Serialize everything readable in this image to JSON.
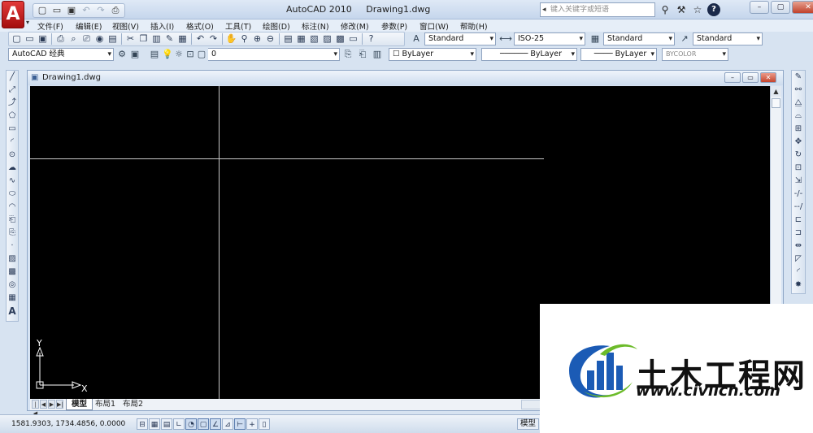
{
  "app": {
    "name": "AutoCAD 2010",
    "document": "Drawing1.dwg",
    "logo_letter": "A"
  },
  "search": {
    "placeholder": "键入关键字或短语"
  },
  "menu": [
    "文件(F)",
    "编辑(E)",
    "视图(V)",
    "插入(I)",
    "格式(O)",
    "工具(T)",
    "绘图(D)",
    "标注(N)",
    "修改(M)",
    "参数(P)",
    "窗口(W)",
    "帮助(H)"
  ],
  "styles": {
    "text_style": "Standard",
    "dim_style": "ISO-25",
    "table_style": "Standard",
    "multileader_style": "Standard"
  },
  "toolbar2": {
    "workspace": "AutoCAD 经典",
    "layer": "0",
    "color": "ByLayer",
    "linetype": "ByLayer",
    "lineweight": "ByLayer",
    "plotstyle": "BYCOLOR"
  },
  "drawing_window": {
    "title": "Drawing1.dwg",
    "ucs_y": "Y",
    "ucs_x": "X"
  },
  "layout_tabs": [
    "模型",
    "布局1",
    "布局2"
  ],
  "status": {
    "coordinates": "1581.9303,  1734.4856,  0.0000",
    "model_label": "模型"
  },
  "watermark": {
    "cn_text": "土木工程网",
    "url": "www.civilcn.com",
    "colors": {
      "blue": "#1b5bb5",
      "green": "#6cbb2a"
    }
  },
  "icons": {
    "quick_access": [
      "new-icon",
      "open-icon",
      "save-icon",
      "undo-icon",
      "redo-icon",
      "plot-icon"
    ],
    "help": [
      "binoculars-icon",
      "wrench-icon",
      "star-icon",
      "help-icon"
    ]
  }
}
